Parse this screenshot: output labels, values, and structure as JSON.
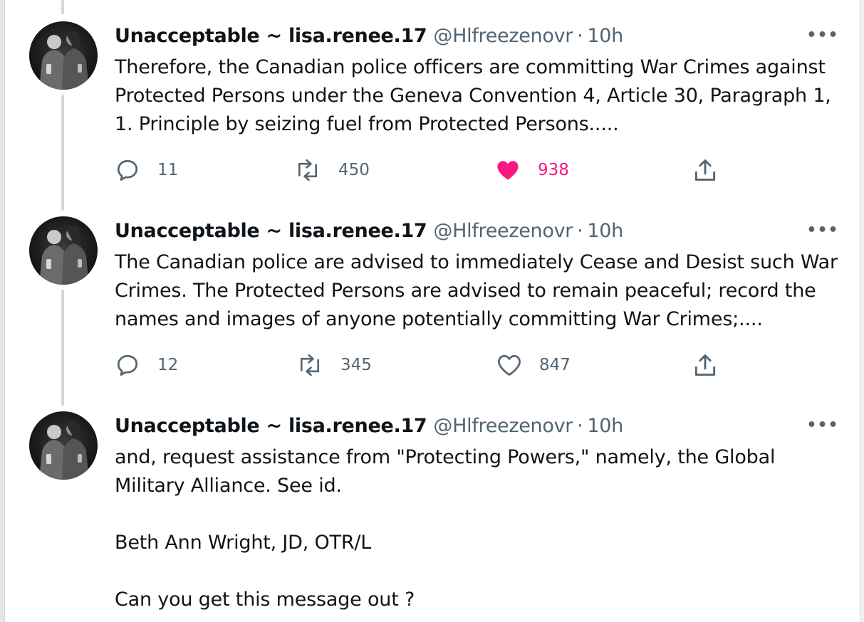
{
  "tweets": [
    {
      "display_name": "Unacceptable ~ lisa.renee.17",
      "handle": "@Hlfreezenovr",
      "separator": "·",
      "time": "10h",
      "more_label": "•••",
      "text": "Therefore, the Canadian police officers are committing War Crimes against\nProtected Persons under the Geneva Convention 4, Article 30, Paragraph 1,\n1. Principle by seizing fuel from Protected Persons.....",
      "replies": "11",
      "retweets": "450",
      "likes": "938",
      "liked": true
    },
    {
      "display_name": "Unacceptable ~ lisa.renee.17",
      "handle": "@Hlfreezenovr",
      "separator": "·",
      "time": "10h",
      "more_label": "•••",
      "text": "The Canadian police are advised to immediately Cease and Desist such War\nCrimes. The Protected Persons are advised to remain peaceful; record the\nnames and images of anyone potentially committing War Crimes;....",
      "replies": "12",
      "retweets": "345",
      "likes": "847",
      "liked": false
    },
    {
      "display_name": "Unacceptable ~ lisa.renee.17",
      "handle": "@Hlfreezenovr",
      "separator": "·",
      "time": "10h",
      "more_label": "•••",
      "text": "and, request assistance from \"Protecting Powers,\" namely, the Global\nMilitary Alliance. See id.\n\nBeth Ann Wright, JD, OTR/L\n\nCan you get this message out ?"
    }
  ],
  "colors": {
    "text": "#0f1419",
    "secondary": "#536471",
    "like_active": "#f91880",
    "thread_line": "#cfd9de"
  },
  "icons": {
    "reply": "reply-icon",
    "retweet": "retweet-icon",
    "like": "heart-icon",
    "share": "share-icon",
    "more": "more-icon"
  }
}
